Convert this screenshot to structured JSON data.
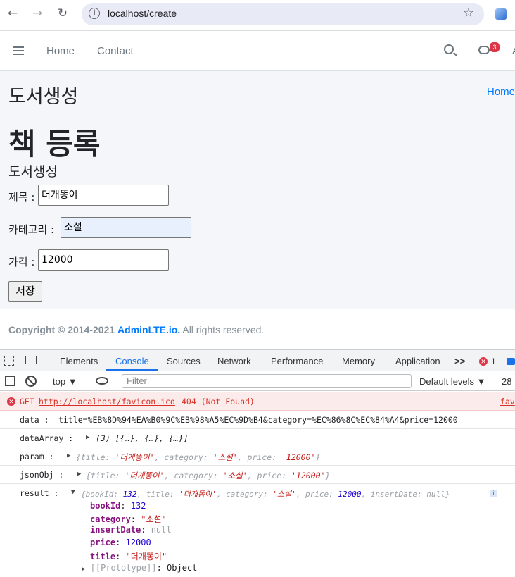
{
  "browser": {
    "url": "localhost/create"
  },
  "navbar": {
    "home_label": "Home",
    "contact_label": "Contact",
    "chat_badge": "3",
    "overflow_glyph": "A"
  },
  "page": {
    "header_title": "도서생성",
    "breadcrumb_home": "Home",
    "h1": "책 등록",
    "h3": "도서생성"
  },
  "form": {
    "title_label": "제목 :",
    "title_value": "더개똥이",
    "category_label": "카테고리 :",
    "category_value": "소설",
    "price_label": "가격 :",
    "price_value": "12000",
    "save_label": "저장"
  },
  "footer": {
    "copyright": "Copyright © 2014-2021",
    "brand": "AdminLTE.io.",
    "rights": "All rights reserved."
  },
  "devtools": {
    "tabs": [
      "Elements",
      "Console",
      "Sources",
      "Network",
      "Performance",
      "Memory",
      "Application"
    ],
    "active_tab": "Console",
    "more_tabs": ">>",
    "error_count": "1",
    "context": "top",
    "filter_placeholder": "Filter",
    "levels": "Default levels",
    "issues_count": "28",
    "console": {
      "error": {
        "method": "GET",
        "url": "http://localhost/favicon.ico",
        "status": "404 (Not Found)",
        "source": "fav"
      },
      "data_label": "data  :",
      "data_value": "title=%EB%8D%94%EA%B0%9C%EB%98%A5%EC%9D%B4&category=%EC%86%8C%EC%84%A4&price=12000",
      "dataArray_label": "dataArray  :",
      "dataArray_value": "(3) [{…}, {…}, {…}]",
      "param_label": "param  :",
      "param_value_prefix": "{title: ",
      "param_title": "'더개똥이'",
      "param_cat_key": ", category: ",
      "param_cat": "'소설'",
      "param_price_key": ", price: ",
      "param_price": "'12000'",
      "param_close": "}",
      "jsonObj_label": "jsonObj  :",
      "result_label": "result  :",
      "result_open": "{bookId: ",
      "result_bookId": "132",
      "result_title_key": ", title: ",
      "result_title": "'더개똥이'",
      "result_cat_key": ", category: ",
      "result_cat": "'소설'",
      "result_price_key": ", price: ",
      "result_price": "12000",
      "result_insert_key": ", insertDate: ",
      "result_insert": "null",
      "result_close": "}",
      "info_badge": "i",
      "props": {
        "bookId_key": "bookId",
        "bookId_val": "132",
        "category_key": "category",
        "category_val": "\"소설\"",
        "insertDate_key": "insertDate",
        "insertDate_val": "null",
        "price_key": "price",
        "price_val": "12000",
        "title_key": "title",
        "title_val": "\"더개똥이\"",
        "prototype_key": "[[Prototype]]",
        "prototype_val": "Object"
      }
    }
  }
}
